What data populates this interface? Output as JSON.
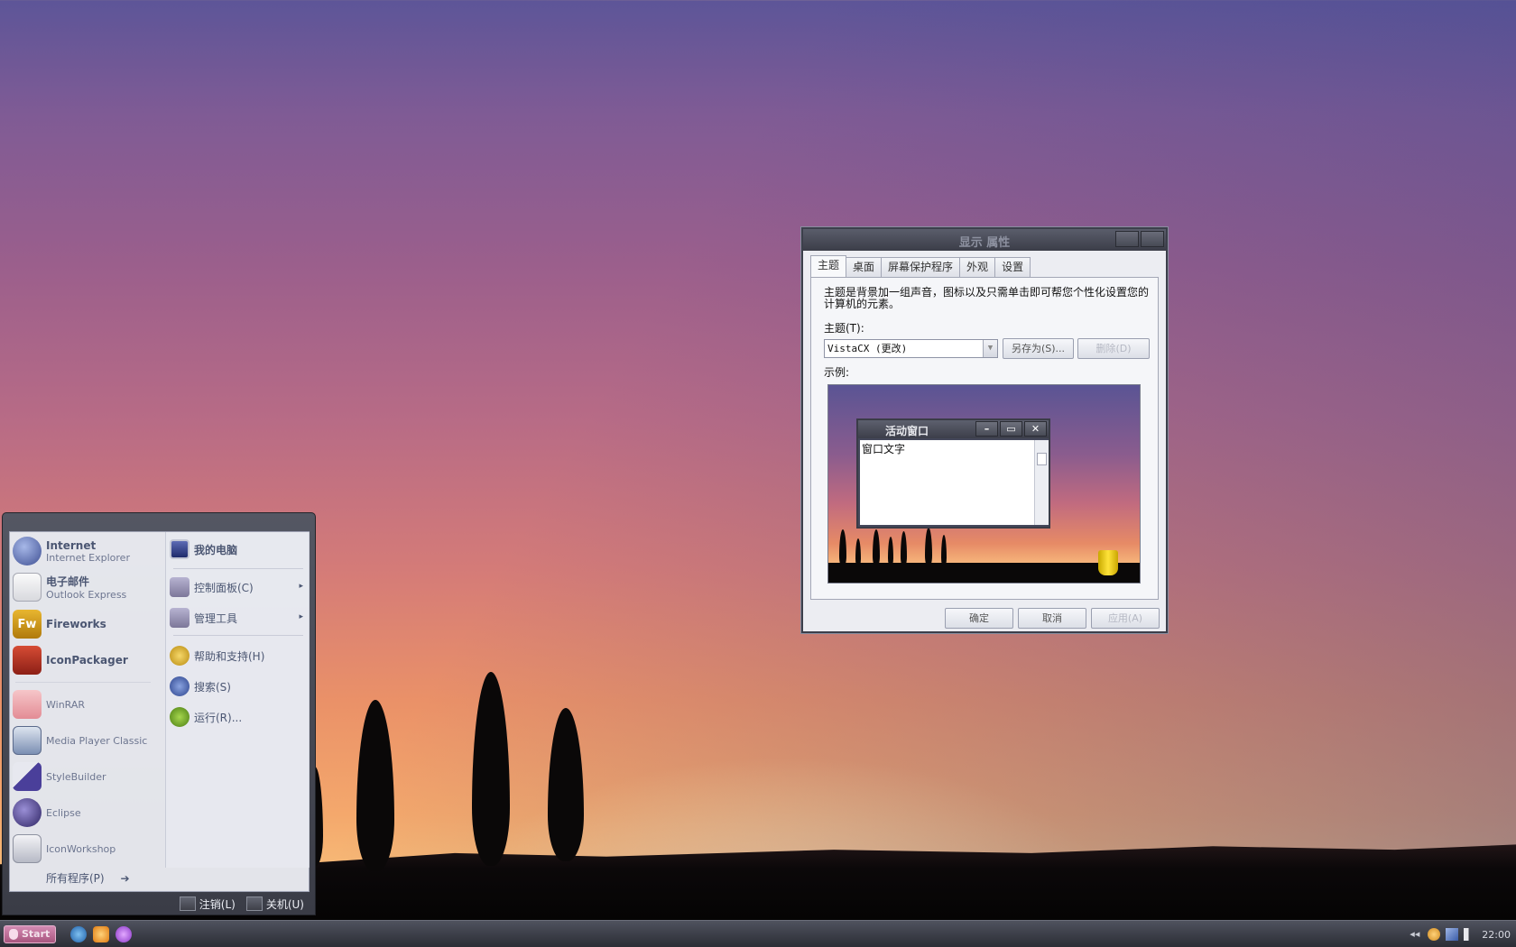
{
  "start_menu": {
    "pinned": [
      {
        "title": "Internet",
        "sub": "Internet Explorer"
      },
      {
        "title": "电子邮件",
        "sub": "Outlook Express"
      },
      {
        "title": "Fireworks"
      },
      {
        "title": "IconPackager"
      }
    ],
    "recent": [
      "WinRAR",
      "Media Player Classic",
      "StyleBuilder",
      "Eclipse",
      "IconWorkshop"
    ],
    "all_programs": "所有程序(P)",
    "right": [
      {
        "label": "我的电脑"
      },
      {
        "label": "控制面板(C)",
        "arrow": "▸"
      },
      {
        "label": "管理工具",
        "arrow": "▸"
      },
      {
        "label": "帮助和支持(H)"
      },
      {
        "label": "搜索(S)"
      },
      {
        "label": "运行(R)..."
      }
    ],
    "logoff": "注销(L)",
    "shutdown": "关机(U)"
  },
  "dialog": {
    "title": "显示 属性",
    "tabs": [
      "主题",
      "桌面",
      "屏幕保护程序",
      "外观",
      "设置"
    ],
    "description": "主题是背景加一组声音，图标以及只需单击即可帮您个性化设置您的计算机的元素。",
    "theme_label": "主题(T):",
    "theme_value": "VistaCX (更改)",
    "save_as": "另存为(S)...",
    "delete": "删除(D)",
    "sample_label": "示例:",
    "preview_window_title": "活动窗口",
    "preview_window_text": "窗口文字",
    "ok": "确定",
    "cancel": "取消",
    "apply": "应用(A)"
  },
  "taskbar": {
    "start": "Start",
    "clock": "22:00"
  },
  "colors": {
    "taskbar": "#2b2d35",
    "start_button": "#a8567f",
    "dialog_frame": "#3c3f4b"
  }
}
